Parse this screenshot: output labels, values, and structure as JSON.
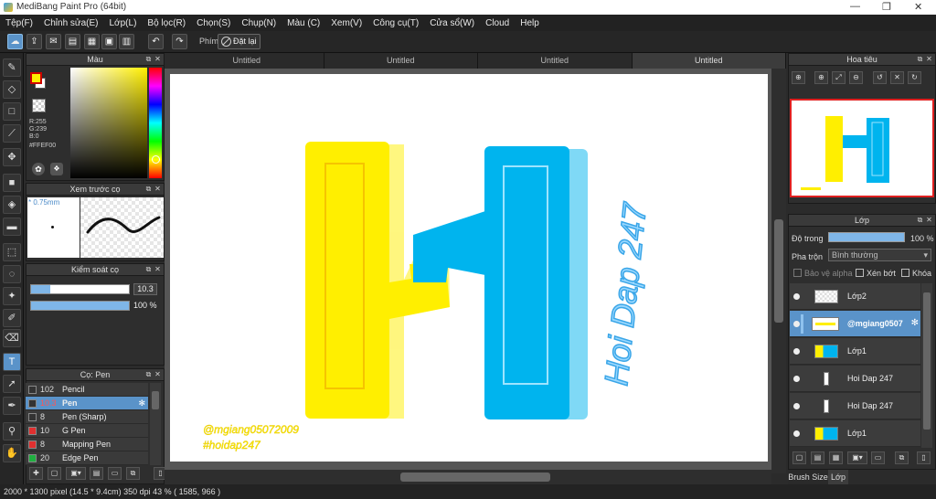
{
  "window": {
    "title": "MediBang Paint Pro (64bit)"
  },
  "menu": [
    "Tệp(F)",
    "Chỉnh sửa(E)",
    "Lớp(L)",
    "Bộ lọc(R)",
    "Chọn(S)",
    "Chụp(N)",
    "Màu (C)",
    "Xem(V)",
    "Công cụ(T)",
    "Cửa sổ(W)",
    "Cloud",
    "Help"
  ],
  "toolbar": {
    "pen_label": "Phím",
    "reset_label": "Đặt lại"
  },
  "tabs": [
    "Untitled",
    "Untitled",
    "Untitled",
    "Untitled"
  ],
  "color_panel": {
    "title": "Màu",
    "r": "R:255",
    "g": "G:239",
    "b": "B:0",
    "hex": "#FFEF00",
    "fg": "#FFEF00",
    "bg": "#FFFFFF"
  },
  "brush_preview": {
    "title": "Xem trước cọ",
    "size": "* 0.75mm"
  },
  "brush_control": {
    "title": "Kiểm soát cọ",
    "size_value": "10.3",
    "opacity_value": "100 %"
  },
  "brush_list": {
    "title": "Cọ: Pen",
    "items": [
      {
        "size": "102",
        "name": "Pencil",
        "color": "#333333"
      },
      {
        "size": "10.3",
        "name": "Pen",
        "color": "#333333"
      },
      {
        "size": "8",
        "name": "Pen (Sharp)",
        "color": "#333333"
      },
      {
        "size": "10",
        "name": "G Pen",
        "color": "#e03030"
      },
      {
        "size": "8",
        "name": "Mapping Pen",
        "color": "#e03030"
      },
      {
        "size": "20",
        "name": "Edge Pen",
        "color": "#20b040"
      }
    ]
  },
  "canvas": {
    "watermark_line1": "@mgiang05072009",
    "watermark_line2": "#hoidap247",
    "side_text": "Hoi Dap 247"
  },
  "navigator": {
    "title": "Hoa tiêu"
  },
  "layers_panel": {
    "title": "Lớp",
    "opacity_label": "Độ trong",
    "opacity_value": "100 %",
    "blend_label": "Pha trộn",
    "blend_value": "Bình thường",
    "protect_alpha": "Bảo vệ alpha",
    "clip": "Xén bớt",
    "lock": "Khóa",
    "layers": [
      {
        "name": "Lớp2"
      },
      {
        "name": "@mgiang0507"
      },
      {
        "name": "Lớp1"
      },
      {
        "name": "Hoi Dap 247"
      },
      {
        "name": "Hoi Dap 247"
      },
      {
        "name": "Lớp1"
      }
    ]
  },
  "bottom_tabs": [
    "Brush Size",
    "Lớp"
  ],
  "status": {
    "text": "2000 * 1300 pixel   (14.5 * 9.4cm)   350 dpi   43 %   ( 1585, 966 )"
  },
  "colors": {
    "yellow": "#FFEF00",
    "blue": "#00B4EE",
    "accent": "#5A93C9"
  }
}
